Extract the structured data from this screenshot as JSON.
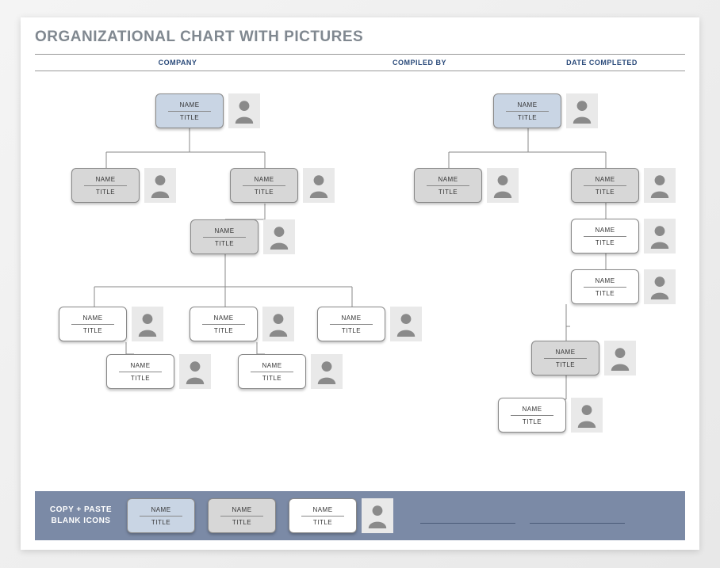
{
  "header": {
    "title": "ORGANIZATIONAL CHART WITH PICTURES",
    "company_label": "COMPANY",
    "compiled_by_label": "COMPILED BY",
    "date_completed_label": "DATE COMPLETED"
  },
  "labels": {
    "name": "NAME",
    "title": "TITLE"
  },
  "footer": {
    "label_line1": "COPY + PASTE",
    "label_line2": "BLANK ICONS"
  },
  "tree_left": {
    "root": {
      "name": "NAME",
      "title": "TITLE",
      "style": "blue"
    },
    "level2": [
      {
        "name": "NAME",
        "title": "TITLE",
        "style": "gray"
      },
      {
        "name": "NAME",
        "title": "TITLE",
        "style": "gray"
      }
    ],
    "level3": [
      {
        "name": "NAME",
        "title": "TITLE",
        "style": "gray"
      }
    ],
    "level4": [
      {
        "name": "NAME",
        "title": "TITLE",
        "style": "white"
      },
      {
        "name": "NAME",
        "title": "TITLE",
        "style": "white"
      },
      {
        "name": "NAME",
        "title": "TITLE",
        "style": "white"
      }
    ],
    "level5": [
      {
        "name": "NAME",
        "title": "TITLE",
        "style": "white"
      },
      {
        "name": "NAME",
        "title": "TITLE",
        "style": "white"
      }
    ]
  },
  "tree_right": {
    "root": {
      "name": "NAME",
      "title": "TITLE",
      "style": "blue"
    },
    "level2": [
      {
        "name": "NAME",
        "title": "TITLE",
        "style": "gray"
      },
      {
        "name": "NAME",
        "title": "TITLE",
        "style": "gray"
      }
    ],
    "level3": [
      {
        "name": "NAME",
        "title": "TITLE",
        "style": "white"
      },
      {
        "name": "NAME",
        "title": "TITLE",
        "style": "white"
      }
    ],
    "level4": [
      {
        "name": "NAME",
        "title": "TITLE",
        "style": "gray"
      }
    ],
    "level5": [
      {
        "name": "NAME",
        "title": "TITLE",
        "style": "white"
      }
    ]
  },
  "templates": [
    {
      "name": "NAME",
      "title": "TITLE",
      "style": "blue"
    },
    {
      "name": "NAME",
      "title": "TITLE",
      "style": "gray"
    },
    {
      "name": "NAME",
      "title": "TITLE",
      "style": "white"
    }
  ]
}
